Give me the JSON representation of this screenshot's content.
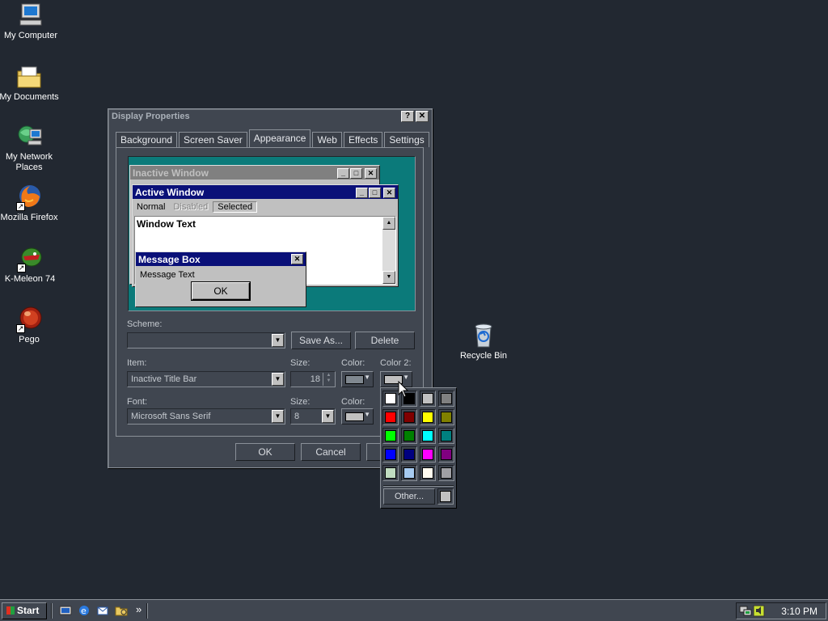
{
  "desktop": {
    "icons": [
      {
        "label": "My Computer",
        "icon": "computer-icon"
      },
      {
        "label": "My Documents",
        "icon": "folder-icon"
      },
      {
        "label": "My Network Places",
        "icon": "network-icon"
      },
      {
        "label": "Mozilla Firefox",
        "icon": "firefox-icon"
      },
      {
        "label": "K-Meleon 74",
        "icon": "k-meleon-icon"
      },
      {
        "label": "Pego",
        "icon": "pego-icon"
      },
      {
        "label": "Recycle Bin",
        "icon": "recycle-bin-icon"
      }
    ]
  },
  "dialog": {
    "title": "Display Properties",
    "help": "?",
    "close": "✕",
    "tabs": [
      "Background",
      "Screen Saver",
      "Appearance",
      "Web",
      "Effects",
      "Settings"
    ],
    "active_tab": "Appearance",
    "preview": {
      "inactive_title": "Inactive Window",
      "active_title": "Active Window",
      "menu": {
        "normal": "Normal",
        "disabled": "Disabled",
        "selected": "Selected"
      },
      "window_text": "Window Text",
      "message_title": "Message Box",
      "message_text": "Message Text",
      "ok": "OK"
    },
    "scheme": {
      "label": "Scheme:",
      "value": "",
      "save_as": "Save As...",
      "delete": "Delete"
    },
    "item": {
      "label": "Item:",
      "value": "Inactive Title Bar",
      "size_label": "Size:",
      "size_value": "18",
      "color_label": "Color:",
      "color2_label": "Color 2:"
    },
    "font": {
      "label": "Font:",
      "value": "Microsoft Sans Serif",
      "size_label": "Size:",
      "size_value": "8",
      "color_label": "Color:"
    },
    "buttons": {
      "ok": "OK",
      "cancel": "Cancel"
    }
  },
  "colors": {
    "item_color": "#808890",
    "item_color2": "#c0c0c0",
    "font_color": "#c0c0c0",
    "active_title": "#0a1078",
    "preview_bg": "#0b7a7a"
  },
  "palette": {
    "colors": [
      "#ffffff",
      "#000000",
      "#c0c0c0",
      "#808080",
      "#ff0000",
      "#800000",
      "#ffff00",
      "#808000",
      "#00ff00",
      "#008000",
      "#00ffff",
      "#008080",
      "#0000ff",
      "#000080",
      "#ff00ff",
      "#800080",
      "#c0dcc0",
      "#a6caf0",
      "#fffbf0",
      "#a0a0a4"
    ],
    "other_label": "Other...",
    "other_color": "#c0c0c0"
  },
  "taskbar": {
    "start_label": "Start",
    "chevron": "»",
    "clock": "3:10 PM"
  }
}
